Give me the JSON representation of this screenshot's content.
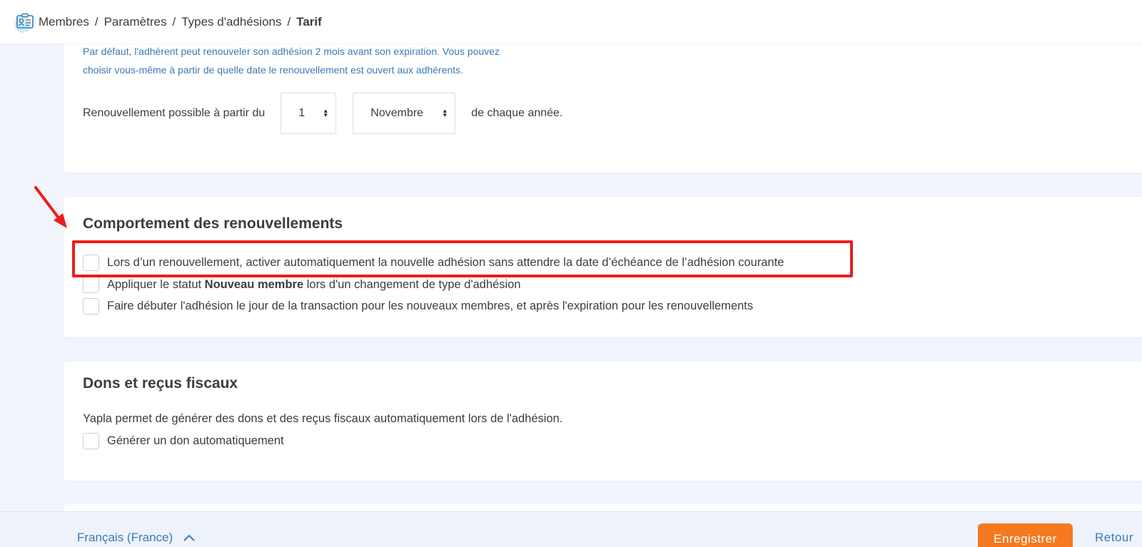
{
  "breadcrumb": {
    "items": [
      "Membres",
      "Paramètres",
      "Types d'adhésions"
    ],
    "current": "Tarif",
    "separator": "/"
  },
  "renewal": {
    "info_line1": "Par défaut, l'adhérent peut renouveler son adhésion 2 mois avant son expiration. Vous pouvez",
    "info_line2": "choisir vous-même à partir de quelle date le renouvellement est ouvert aux adhérents.",
    "label": "Renouvellement possible à partir du",
    "day_value": "1",
    "month_value": "Novembre",
    "suffix": "de chaque année."
  },
  "behavior": {
    "title": "Comportement des renouvellements",
    "options": [
      {
        "label": "Lors d’un renouvellement, activer automatiquement la nouvelle adhésion sans attendre la date d’échéance de l’adhésion courante",
        "checked": false
      },
      {
        "label_before": "Appliquer le statut ",
        "label_bold": "Nouveau membre",
        "label_after": " lors d'un changement de type d'adhésion",
        "checked": false
      },
      {
        "label": "Faire débuter l'adhésion le jour de la transaction pour les nouveaux membres, et après l'expiration pour les renouvellements",
        "checked": false
      }
    ]
  },
  "donations": {
    "title": "Dons et reçus fiscaux",
    "description": "Yapla permet de générer des dons et des reçus fiscaux automatiquement lors de l'adhésion.",
    "option_label": "Générer un don automatiquement"
  },
  "footer": {
    "language": "Français (France)",
    "save_label": "Enregistrer",
    "back_label": "Retour"
  },
  "colors": {
    "accent_orange": "#f47920",
    "link_blue": "#3a7bb5",
    "annotation_red": "#ee1c1c",
    "background": "#f2f5fb"
  },
  "icons": [
    "membership-card-icon",
    "sort-arrows-icon",
    "chevron-up-icon",
    "red-arrow-annotation"
  ]
}
